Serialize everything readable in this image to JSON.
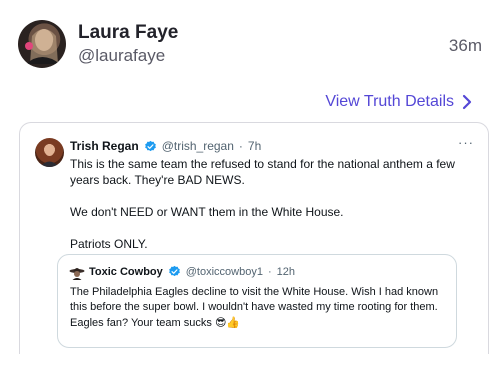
{
  "post": {
    "author": {
      "display_name": "Laura Faye",
      "handle": "@laurafaye",
      "avatar_icon": "profile-photo"
    },
    "timestamp": "36m",
    "view_details_label": "View Truth Details",
    "link_color": "#5447d6"
  },
  "embedded_tweet": {
    "author": {
      "display_name": "Trish Regan",
      "handle": "@trish_regan",
      "separator": "·",
      "time": "7h",
      "verified": true
    },
    "more_label": "···",
    "body": [
      "This is the same team the refused to stand for the national anthem a few years back. They're BAD NEWS.",
      "We don't NEED or WANT them in the White House.",
      "Patriots ONLY."
    ],
    "quoted": {
      "author": {
        "display_name": "Toxic Cowboy",
        "handle": "@toxiccowboy1",
        "separator": "·",
        "time": "12h",
        "verified": true
      },
      "body": "The Philadelphia Eagles decline to visit the White House. Wish I had known this before the super bowl. I wouldn't have wasted my time rooting for them. Eagles fan? Your team sucks",
      "emojis": "😎👍"
    },
    "verified_color": "#1d9bf0"
  }
}
